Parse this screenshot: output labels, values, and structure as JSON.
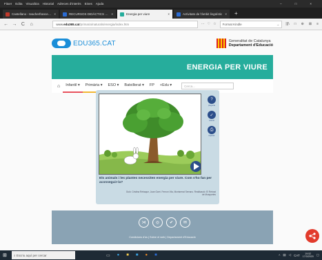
{
  "menubar": {
    "items": [
      "Fitxer",
      "Edita",
      "Visualitza",
      "Historial",
      "Adreces d'interès",
      "Eines",
      "Ajuda"
    ],
    "controls": [
      "–",
      "□",
      "×"
    ]
  },
  "tabs": [
    {
      "title": "Castellano - teacherfrancesc@",
      "close": "×",
      "color": "#c0392b"
    },
    {
      "title": "RECURSOS DIDÀCTICS muy: 1",
      "close": "×",
      "color": "#2b6cd4"
    },
    {
      "title": "Energia per viure",
      "close": "×",
      "color": "#26ad9c"
    },
    {
      "title": "Activitats de l'àmbit lingüístic",
      "close": "×",
      "color": "#2b6cd4"
    }
  ],
  "new_tab": "+",
  "navbar": {
    "back": "←",
    "forward": "→",
    "reload": "C",
    "home": "⌂",
    "url_prefix": "www.",
    "url_domain": "edu365.cat",
    "url_path": "/primaria/naturals/energia/index.htm",
    "url_tools": [
      "···",
      "♡",
      "☆"
    ],
    "search_placeholder": "Format Kindle",
    "search_go": "→",
    "toolbar_icons": [
      "|||\\",
      "□",
      "⊕",
      "⊠",
      "≡"
    ]
  },
  "header": {
    "logo_text": "EDU365.CAT",
    "gencat_line1": "Generalitat de Catalunya",
    "gencat_line2": "Departament d'Educació"
  },
  "banner": {
    "title": "ENERGIA PER VIURE"
  },
  "nav": {
    "items": [
      {
        "label": "Infantil ▾",
        "color": "#e8505b"
      },
      {
        "label": "Primària ▾",
        "color": "#f2b632"
      },
      {
        "label": "ESO ▾",
        "color": "#3aa3e3"
      },
      {
        "label": "Batxillerat ▾",
        "color": "#5bb06a"
      },
      {
        "label": "FP",
        "color": "#7b5ea7"
      },
      {
        "label": "+Edu ▾",
        "color": "#26ad9c"
      }
    ],
    "search_placeholder": "Cerca..."
  },
  "content": {
    "side_icons": [
      {
        "glyph": "?",
        "label": "pregunta"
      },
      {
        "glyph": "✓",
        "label": "solució"
      },
      {
        "glyph": "⎙",
        "label": "imprimir"
      }
    ],
    "question": "Els animals i les plantes necessiten energia per viure. Com s'ho fan per aconseguir-la?",
    "credits": "Guió: Cristina Rebaque, Joan Garrí. Fernon Vila, Montserrat Serrano. Realització: El Rebost de Mosquetes"
  },
  "footer": {
    "social": [
      "⋊",
      "◎",
      "✔",
      "✉"
    ],
    "links": "Condicions d'ús  |  Sobre el web  |  Departament d'Educació"
  },
  "taskbar": {
    "search_placeholder": "Escriu aquí per cercar",
    "time": "19:52",
    "date": "17/3/2020",
    "lang": "CAT"
  }
}
